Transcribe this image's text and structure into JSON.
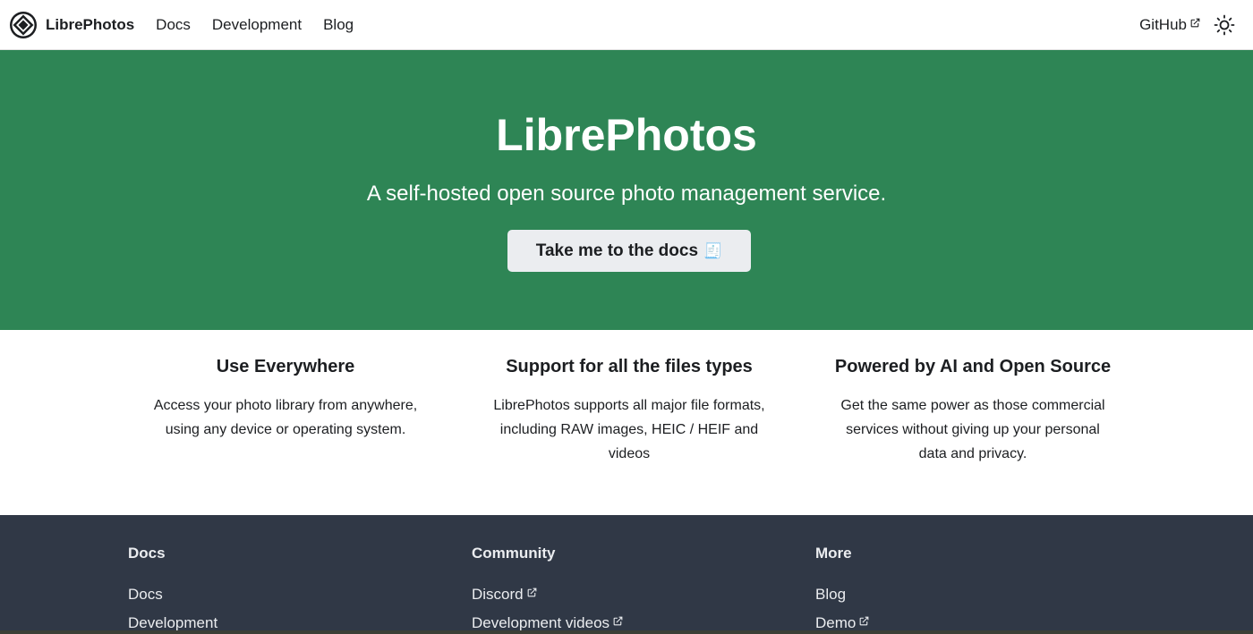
{
  "navbar": {
    "brand": "LibrePhotos",
    "links": [
      "Docs",
      "Development",
      "Blog"
    ],
    "github": "GitHub"
  },
  "hero": {
    "title": "LibrePhotos",
    "subtitle": "A self-hosted open source photo management service.",
    "button": "Take me to the docs",
    "button_emoji": "🧾"
  },
  "features": [
    {
      "title": "Use Everywhere",
      "description_lines": [
        "Access your photo library from anywhere,",
        "using any device or operating system."
      ]
    },
    {
      "title": "Support for all the files types",
      "description_lines": [
        "LibrePhotos supports all major file formats,",
        "including RAW images, HEIC / HEIF and",
        "videos"
      ]
    },
    {
      "title": "Powered by AI and Open Source",
      "description_lines": [
        "Get the same power as those commercial",
        "services without giving up your personal",
        "data and privacy."
      ]
    }
  ],
  "footer": {
    "columns": [
      {
        "title": "Docs",
        "links": [
          "Docs",
          "Development"
        ]
      },
      {
        "title": "Community",
        "links": [
          "Discord",
          "Development videos"
        ]
      },
      {
        "title": "More",
        "links": [
          "Blog",
          "Demo"
        ]
      }
    ]
  },
  "colors": {
    "hero_bg": "#2e8555",
    "footer_bg": "#303846",
    "button_bg": "#ebedf0"
  }
}
